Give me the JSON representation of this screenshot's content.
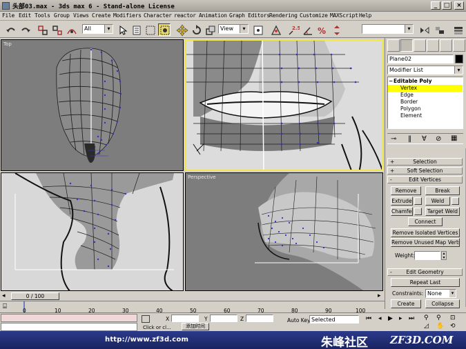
{
  "window": {
    "title": "头部03.max - 3ds max 6 - Stand-alone License"
  },
  "menu": [
    "File",
    "Edit",
    "Tools",
    "Group",
    "Views",
    "Create",
    "Modifiers",
    "Character",
    "reactor",
    "Animation",
    "Graph Editors",
    "Rendering",
    "Customize",
    "MAXScript",
    "Help"
  ],
  "toolbar": {
    "selection_filter": "All",
    "reference_coord": "View",
    "named_selection": ""
  },
  "viewports": {
    "top_label": "Top",
    "perspective_label": "Perspective"
  },
  "command_panel": {
    "object_name": "Plane02",
    "object_color": "#000000",
    "modifier_list": "Modifier List",
    "stack": {
      "root": "Editable Poly",
      "items": [
        "Vertex",
        "Edge",
        "Border",
        "Polygon",
        "Element"
      ],
      "selected": "Vertex"
    },
    "rollouts": {
      "selection": "Selection",
      "soft_selection": "Soft Selection",
      "edit_vertices": "Edit Vertices",
      "edit_geometry": "Edit Geometry"
    },
    "buttons": {
      "remove": "Remove",
      "break": "Break",
      "extrude": "Extrude",
      "weld": "Weld",
      "chamfer": "Chamfer",
      "target_weld": "Target Weld",
      "connect": "Connect",
      "remove_isolated": "Remove Isolated Vertices",
      "remove_unused": "Remove Unused Map Verts",
      "weight_label": "Weight:",
      "weight_value": "",
      "repeat_last": "Repeat Last",
      "constraints_label": "Constraints:",
      "constraints_value": "None",
      "create": "Create",
      "collapse": "Collapse"
    },
    "rollout_sign_plus": "+",
    "rollout_sign_minus": "-"
  },
  "timeline": {
    "frame": "0 / 100",
    "ticks": [
      "0",
      "10",
      "20",
      "30",
      "40",
      "50",
      "60",
      "70",
      "80",
      "90",
      "100"
    ]
  },
  "status": {
    "x_label": "X",
    "y_label": "Y",
    "z_label": "Z",
    "autokey": "Auto Key",
    "key_mode": "Selected",
    "prompt_left": "Click or cl...",
    "prompt_mid": "添加时间"
  },
  "watermark": {
    "url": "http://www.zf3d.com",
    "brand_cn": "朱峰社区",
    "brand_en": "ZF3D.COM"
  },
  "colors": {
    "active_viewport_border": "#f2e84a",
    "selection_highlight": "#ffff00",
    "vertex_color": "#2020c0",
    "watermark_bar": "#1a2462"
  }
}
